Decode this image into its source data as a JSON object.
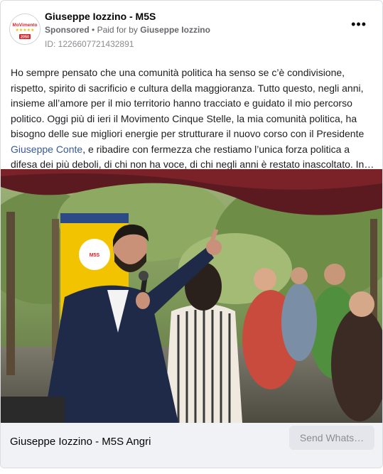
{
  "header": {
    "page_name": "Giuseppe Iozzino - M5S",
    "sponsored": "Sponsored",
    "separator": "•",
    "paid_for_prefix": "Paid for by",
    "paid_for_name": "Giuseppe Iozzino",
    "ad_id": "ID: 1226607721432891",
    "more_label": "•••"
  },
  "avatar": {
    "logo_text": "MoVimento",
    "year": "2050",
    "stars": "★★★★★"
  },
  "post": {
    "text_before_link": "Ho sempre pensato che una comunità politica ha senso se c’è condivisione, rispetto, spirito di sacrificio e cultura della maggioranza. Tutto questo, negli anni, insieme all’amore per il mio territorio hanno tracciato e guidato il mio percorso politico. Oggi più di ieri il Movimento Cinque Stelle, la mia comunità politica, ha bisogno delle sue migliori energie per strutturare il nuovo corso con il Presidente ",
    "link_text": "Giuseppe Conte",
    "text_after_link": ", e ribadire con fermezza che restiamo l’unica forza politica a difesa dei più deboli, di chi non ha voce, di chi negli anni è restato inascoltato. In…"
  },
  "footer": {
    "title": "Giuseppe Iozzino - M5S Angri",
    "cta_label": "Send Whats…"
  },
  "colors": {
    "accent": "#385898",
    "muted": "#65676b",
    "footer_bg": "#f0f2f5",
    "cta_bg": "#e4e6eb",
    "logo_red": "#d8222a",
    "logo_yellow": "#f5c000"
  }
}
